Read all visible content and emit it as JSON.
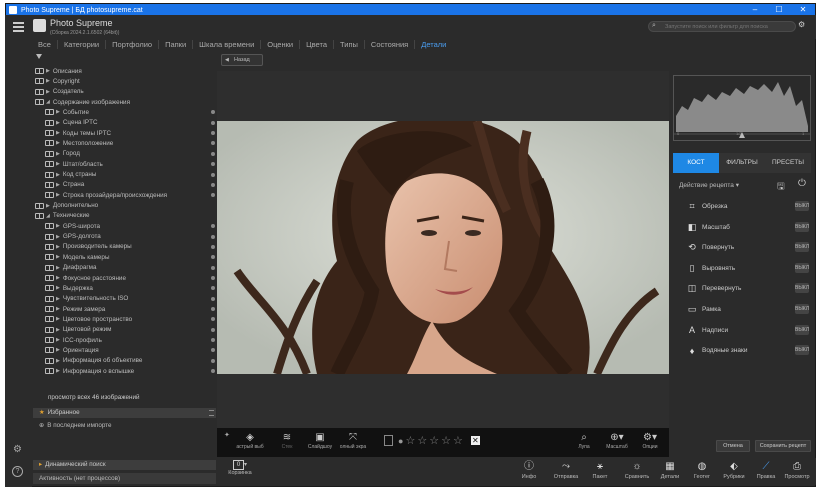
{
  "window": {
    "title": "Photo Supreme | БД photosupreme.cat"
  },
  "app": {
    "name": "Photo Supreme",
    "build": "(Сборка 2024.2.1.6502 (64bit))"
  },
  "search": {
    "placeholder": "Запустите поиск или фильтр для поиска"
  },
  "tabs": [
    "Все",
    "Категории",
    "Портфолио",
    "Папки",
    "Шкала времени",
    "Оценки",
    "Цвета",
    "Типы",
    "Состояния",
    "Детали"
  ],
  "active_tab": "Детали",
  "tree": [
    {
      "label": "Описания",
      "indent": 0,
      "expanded": false
    },
    {
      "label": "Copyright",
      "indent": 0,
      "expanded": false
    },
    {
      "label": "Создатель",
      "indent": 0,
      "expanded": false
    },
    {
      "label": "Содержание изображения",
      "indent": 0,
      "expanded": true
    },
    {
      "label": "Событие",
      "indent": 1,
      "expanded": false
    },
    {
      "label": "Сцена IPTC",
      "indent": 1,
      "expanded": false
    },
    {
      "label": "Коды темы IPTC",
      "indent": 1,
      "expanded": false
    },
    {
      "label": "Местоположение",
      "indent": 1,
      "expanded": false
    },
    {
      "label": "Город",
      "indent": 1,
      "expanded": false
    },
    {
      "label": "Штат/область",
      "indent": 1,
      "expanded": false
    },
    {
      "label": "Код страны",
      "indent": 1,
      "expanded": false
    },
    {
      "label": "Страна",
      "indent": 1,
      "expanded": false
    },
    {
      "label": "Строка прозайдера/происхождения",
      "indent": 1,
      "expanded": false
    },
    {
      "label": "Дополнительно",
      "indent": 0,
      "expanded": false
    },
    {
      "label": "Технические",
      "indent": 0,
      "expanded": true
    },
    {
      "label": "GPS-широта",
      "indent": 1,
      "expanded": false
    },
    {
      "label": "GPS-долгота",
      "indent": 1,
      "expanded": false
    },
    {
      "label": "Производитель камеры",
      "indent": 1,
      "expanded": false
    },
    {
      "label": "Модель камеры",
      "indent": 1,
      "expanded": false
    },
    {
      "label": "Диафрагма",
      "indent": 1,
      "expanded": false
    },
    {
      "label": "Фокусное расстояние",
      "indent": 1,
      "expanded": false
    },
    {
      "label": "Выдержка",
      "indent": 1,
      "expanded": false
    },
    {
      "label": "Чувствительность ISO",
      "indent": 1,
      "expanded": false
    },
    {
      "label": "Режим замера",
      "indent": 1,
      "expanded": false
    },
    {
      "label": "Цветовое пространство",
      "indent": 1,
      "expanded": false
    },
    {
      "label": "Цветовой режим",
      "indent": 1,
      "expanded": false
    },
    {
      "label": "ICC-профиль",
      "indent": 1,
      "expanded": false
    },
    {
      "label": "Ориентация",
      "indent": 1,
      "expanded": false
    },
    {
      "label": "Информация об объективе",
      "indent": 1,
      "expanded": false
    },
    {
      "label": "Информация о вспышке",
      "indent": 1,
      "expanded": false
    }
  ],
  "view_all": "просмотр всех 46 изображений",
  "favorites": {
    "title": "Избранное",
    "recent": "В последнем импорте"
  },
  "dynamic_search": "Динамический поиск",
  "activity": "Активность (нет процессов)",
  "nav": {
    "back": "Назад"
  },
  "viewer_tools": {
    "sharp": "астрый выб",
    "stacks": "Стек",
    "slideshow": "Слайдшоу",
    "zoom": "олный экра",
    "loupe": "Лупа",
    "scale": "Масштаб",
    "options": "Опции"
  },
  "rating": {
    "stars": 0,
    "max": 5
  },
  "status_buttons": {
    "basket": "Корзинка",
    "info": "Инфо",
    "send": "Отправка",
    "batch": "Пакет",
    "compare": "Сравнить",
    "details": "Детали",
    "geotag": "Геотег",
    "tag": "Рубрики",
    "edit": "Правка",
    "view": "Просмотр"
  },
  "basket_count": "0",
  "right_tabs": [
    "КОСТ",
    "ФИЛЬТРЫ",
    "ПРЕСЕТЫ"
  ],
  "active_right_tab": "КОСТ",
  "preset_action": "Действие рецепта",
  "adjustments": [
    {
      "label": "Обрезка",
      "icon": "crop-icon",
      "glyph": "⌗",
      "state": "ВЫКЛ"
    },
    {
      "label": "Масштаб",
      "icon": "scale-icon",
      "glyph": "◧",
      "state": "ВЫКЛ"
    },
    {
      "label": "Повернуть",
      "icon": "rotate-icon",
      "glyph": "⟲",
      "state": "ВЫКЛ"
    },
    {
      "label": "Выровнять",
      "icon": "straighten-icon",
      "glyph": "▯",
      "state": "ВЫКЛ"
    },
    {
      "label": "Перевернуть",
      "icon": "flip-icon",
      "glyph": "◫",
      "state": "ВЫКЛ"
    },
    {
      "label": "Рамка",
      "icon": "frame-icon",
      "glyph": "▭",
      "state": "ВЫКЛ"
    },
    {
      "label": "Надписи",
      "icon": "text-icon",
      "glyph": "A",
      "state": "ВЫКЛ"
    },
    {
      "label": "Водяные знаки",
      "icon": "watermark-icon",
      "glyph": "♦",
      "state": "ВЫКЛ"
    }
  ],
  "buttons": {
    "reset": "Отмена",
    "save_recipe": "Сохранить рецепт"
  },
  "histogram": {
    "label_left": "0",
    "label_mid": "1/2",
    "label_right": "1"
  },
  "colors": {
    "accent": "#1e88e5",
    "titlebar": "#1a73e8",
    "background": "#2b2b2b"
  }
}
